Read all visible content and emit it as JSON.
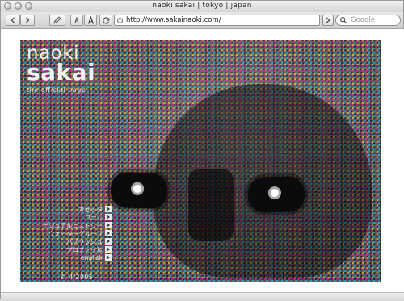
{
  "window": {
    "title": "naoki sakai | tokyo | japan"
  },
  "toolbar": {
    "address_url": "http://www.sakainaoki.com/",
    "search_placeholder": "Google",
    "icons": {
      "back": "left-arrow-icon",
      "forward": "right-arrow-icon",
      "bookmark": "pencil-icon",
      "text_smaller": "text-smaller-icon",
      "text_larger": "text-larger-icon",
      "reload": "reload-icon",
      "page": "page-icon",
      "search": "magnifier-icon"
    }
  },
  "site": {
    "brand_line1": "naoki",
    "brand_line2": "sakai",
    "brand_subtitle": "the official page",
    "menu": [
      {
        "label": "ガゼッタ"
      },
      {
        "label": "コラム"
      },
      {
        "label": "ビジュアルヒストリー"
      },
      {
        "label": "ウォーターグループ"
      },
      {
        "label": "パブリッシュ"
      },
      {
        "label": "プロファイル"
      },
      {
        "label": "english"
      }
    ],
    "copyright": "© 4/2005"
  },
  "colors": {
    "chrome_light": "#f2f2f2",
    "chrome_dark": "#cfcfcf",
    "hero_bg": "#151515",
    "text_on_dark": "#f0f0f0"
  }
}
